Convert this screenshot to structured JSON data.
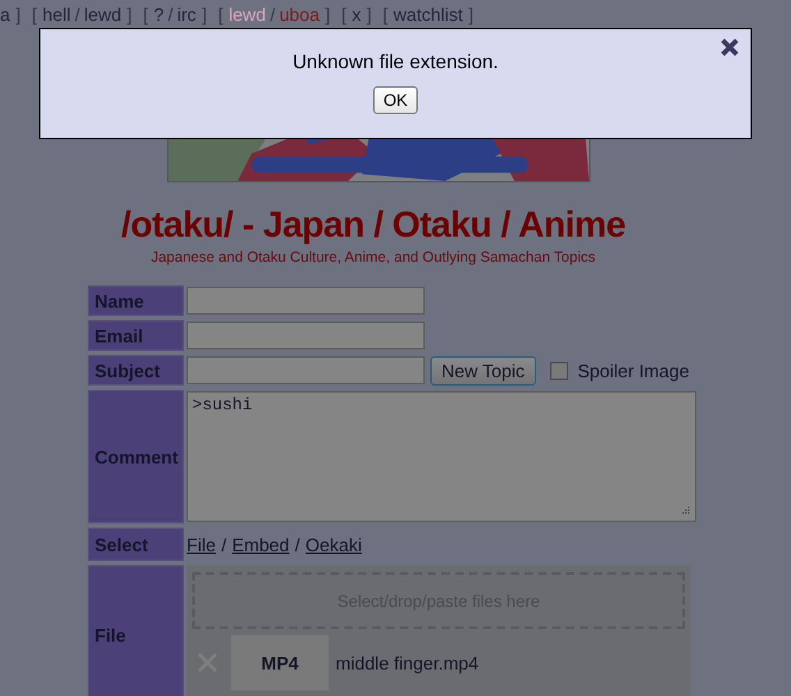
{
  "nav": {
    "divider": "/",
    "groups": [
      {
        "close": "]",
        "items": [
          {
            "label": "a",
            "color": "#25253c"
          }
        ]
      },
      {
        "open": "[",
        "close": "]",
        "items": [
          {
            "label": "hell",
            "color": "#25253c"
          },
          {
            "label": "lewd",
            "color": "#25253c"
          }
        ]
      },
      {
        "open": "[",
        "close": "]",
        "items": [
          {
            "label": "?",
            "color": "#25253c"
          },
          {
            "label": "irc",
            "color": "#25253c"
          }
        ]
      },
      {
        "open": "[",
        "close": "]",
        "items": [
          {
            "label": "lewd",
            "color": "#d8a8b8"
          },
          {
            "label": "uboa",
            "color": "#7a1c1c"
          }
        ]
      },
      {
        "open": "[",
        "close": "]",
        "items": [
          {
            "label": "x",
            "color": "#25253c"
          }
        ]
      },
      {
        "open": "[",
        "close": "]",
        "items": [
          {
            "label": "watchlist",
            "color": "#25253c"
          }
        ]
      }
    ]
  },
  "board": {
    "title": "/otaku/ - Japan / Otaku / Anime",
    "subtitle": "Japanese and Otaku Culture, Anime, and Outlying Samachan Topics"
  },
  "form": {
    "rows": [
      {
        "kind": "text",
        "label": "Name"
      },
      {
        "kind": "text",
        "label": "Email"
      },
      {
        "kind": "subject",
        "label": "Subject",
        "button": "New Topic",
        "checkbox": {
          "label": "Spoiler Image",
          "checked": false
        }
      },
      {
        "kind": "textarea",
        "label": "Comment",
        "value": ">sushi"
      },
      {
        "kind": "links",
        "label": "Select",
        "links": [
          "File",
          "Embed",
          "Oekaki"
        ],
        "divider": "/"
      },
      {
        "kind": "file",
        "label": "File",
        "dropzone": "Select/drop/paste files here",
        "files": [
          {
            "type": "MP4",
            "name": "middle finger.mp4"
          }
        ]
      }
    ]
  },
  "dialog": {
    "message": "Unknown file extension.",
    "button": "OK"
  }
}
